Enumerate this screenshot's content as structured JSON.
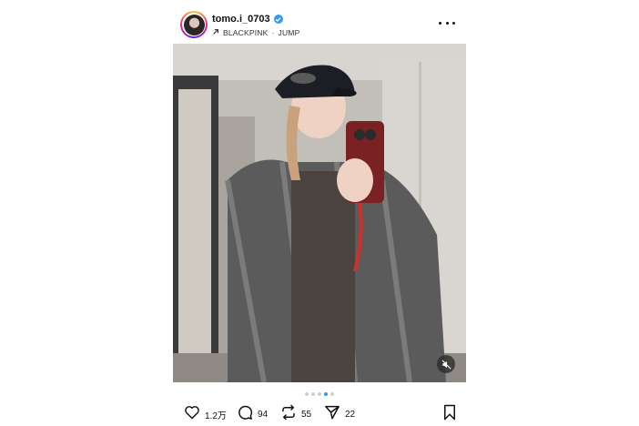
{
  "header": {
    "username": "tomo.i_0703",
    "music_artist": "BLACKPINK",
    "music_separator": "·",
    "music_title": "JUMP"
  },
  "media": {
    "carousel": {
      "count": 5,
      "active_index": 3
    }
  },
  "actions": {
    "likes": "1.2万",
    "comments": "94",
    "reposts": "55",
    "shares": "22"
  },
  "colors": {
    "accent": "#3897f0",
    "verified": "#3897f0",
    "text": "#111111"
  },
  "icons": [
    "verified-icon",
    "arrow-up-right-icon",
    "more-icon",
    "mute-icon",
    "heart-icon",
    "comment-icon",
    "repost-icon",
    "share-icon",
    "bookmark-icon"
  ]
}
